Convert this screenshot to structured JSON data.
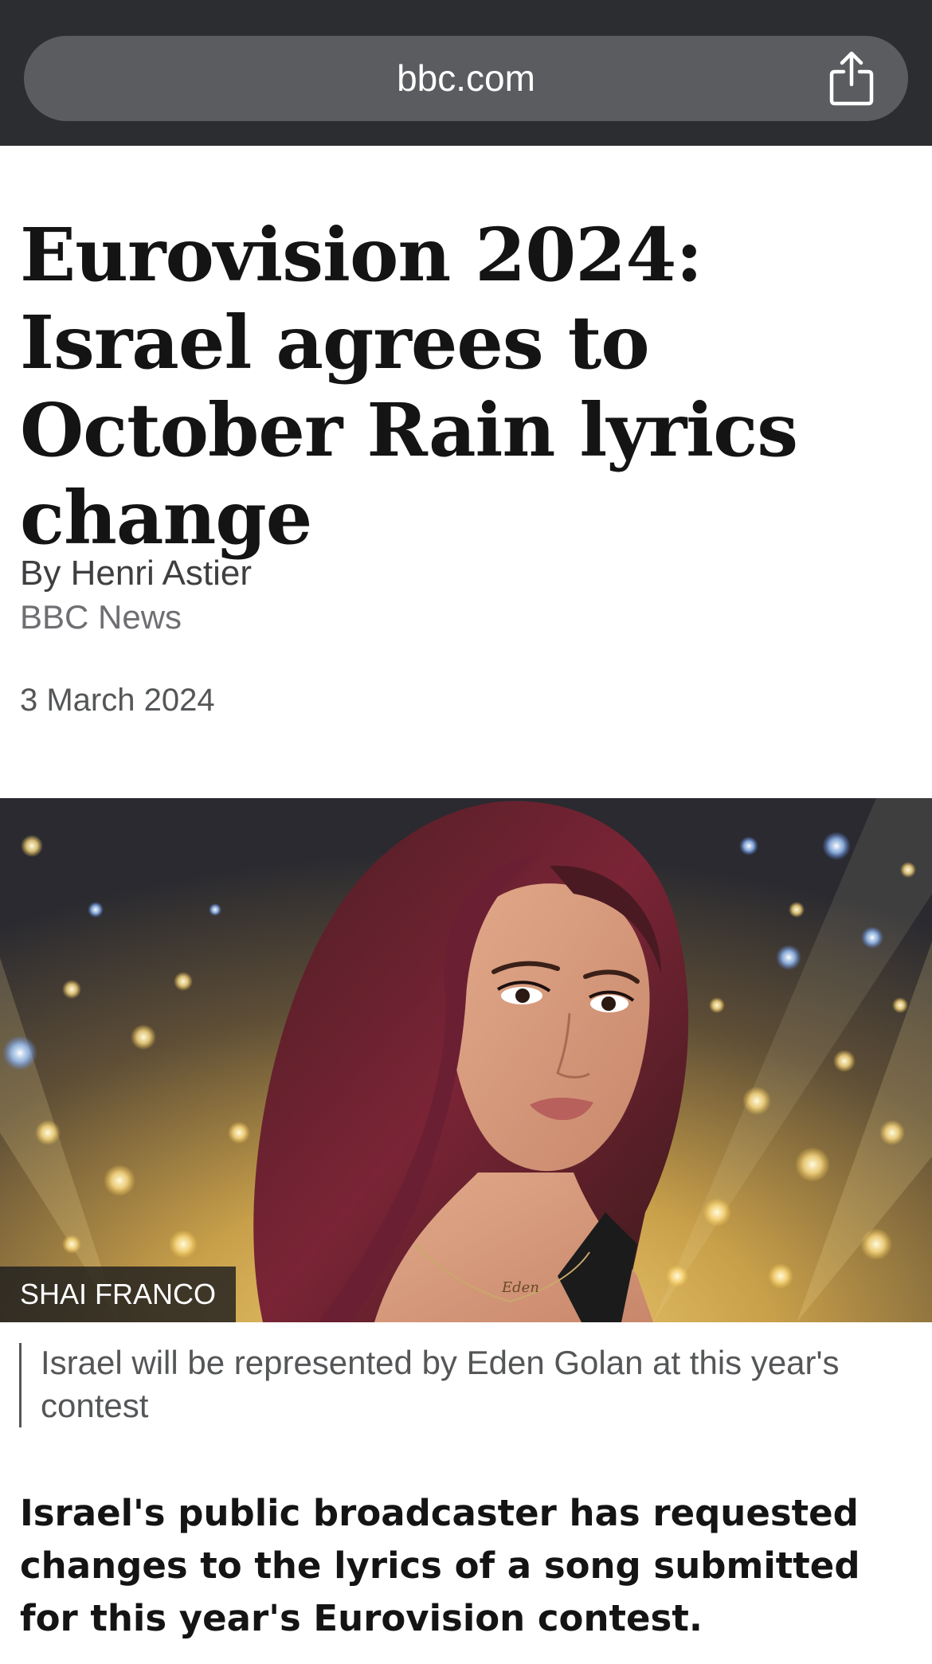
{
  "browser": {
    "url": "bbc.com"
  },
  "article": {
    "headline": "Eurovision 2024: Israel agrees to October Rain lyrics change",
    "byline": "By Henri Astier",
    "source": "BBC News",
    "date": "3 March 2024",
    "image": {
      "credit": "SHAI FRANCO",
      "caption": "Israel will be represented by Eden Golan at this year's contest",
      "necklace_text": "Eden"
    },
    "lead": "Israel's public broadcaster has requested changes to the lyrics of a song submitted for this year's Eurovision contest."
  },
  "colors": {
    "topbar": "#2c2d30",
    "urlbar": "#5b5c60",
    "text": "#141414",
    "muted": "#545658"
  },
  "icons": {
    "share": "share-icon"
  }
}
